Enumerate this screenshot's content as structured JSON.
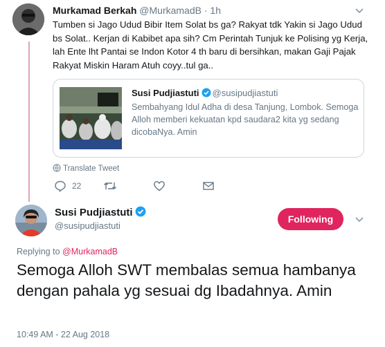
{
  "parent_tweet": {
    "name": "Murkamad Berkah",
    "handle": "@MurkamadB",
    "separator": "·",
    "time": "1h",
    "text": "Tumben si Jago Udud Bibir Item Solat bs ga? Rakyat tdk Yakin si Jago Udud bs Solat.. Kerjan di Kabibet apa sih? Cm Perintah Tunjuk ke Polising yg Kerja, lah Ente lht Pantai se Indon Kotor 4 th baru di bersihkan, makan Gaji Pajak Rakyat Miskin Haram Atuh coyy..tul ga..",
    "quoted": {
      "name": "Susi Pudjiastuti",
      "handle": "@susipudjiastuti",
      "text": "Sembahyang Idul Adha di desa Tanjung, Lombok. Semoga Alloh memberi kekuatan kpd saudara2 kita yg sedang dicobaNya. Amin"
    },
    "translate_label": "Translate Tweet",
    "actions": {
      "reply_count": "22"
    }
  },
  "main_tweet": {
    "name": "Susi Pudjiastuti",
    "handle": "@susipudjiastuti",
    "follow_label": "Following",
    "replying_prefix": "Replying to",
    "replying_to": "@MurkamadB",
    "text": "Semoga Alloh SWT membalas semua hambanya dengan pahala yg sesuai dg Ibadahnya. Amin",
    "timestamp": "10:49 AM - 22 Aug 2018"
  },
  "colors": {
    "accent": "#e0245e",
    "verified": "#1da1f2",
    "secondary_text": "#657786",
    "thread_line": "#e2a4b9"
  }
}
